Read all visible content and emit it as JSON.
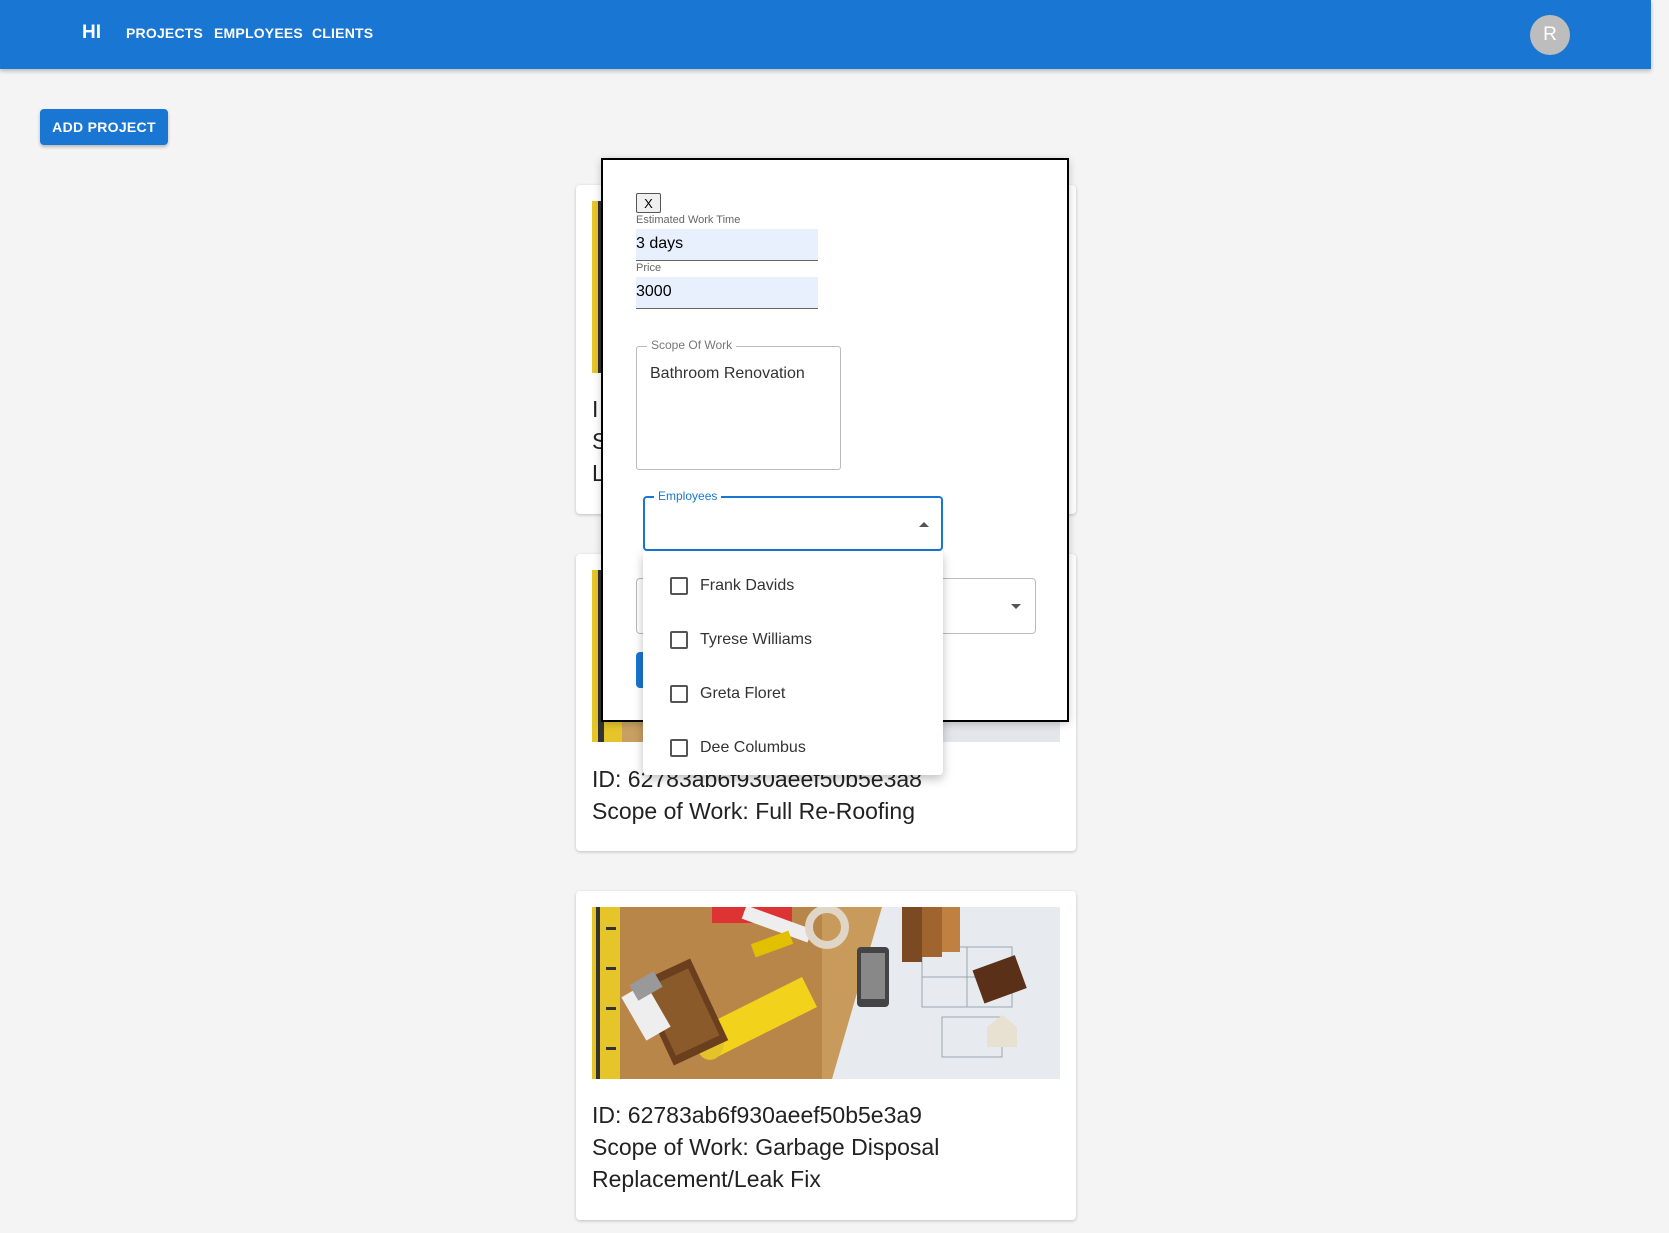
{
  "header": {
    "brand": "HI",
    "nav": [
      "PROJECTS",
      "EMPLOYEES",
      "CLIENTS"
    ],
    "avatar_initial": "R"
  },
  "toolbar": {
    "add_project_label": "ADD PROJECT"
  },
  "cards": [
    {
      "id_line": "ID: 62783ab6f930aeef50b5e3a8",
      "scope_line": "Scope of Work: Full Re-Roofing"
    },
    {
      "id_line": "ID: 62783ab6f930aeef50b5e3a9",
      "scope_line": "Scope of Work: Garbage Disposal Replacement/Leak Fix"
    }
  ],
  "card1_partial_letters": [
    "I",
    "S",
    "L"
  ],
  "modal": {
    "close_label": "X",
    "work_time_label": "Estimated Work Time",
    "work_time_value": "3 days",
    "price_label": "Price",
    "price_value": "3000",
    "scope_label": "Scope Of Work",
    "scope_value": "Bathroom Renovation",
    "employees_label": "Employees",
    "employees_options": [
      "Frank Davids",
      "Tyrese Williams",
      "Greta Floret",
      "Dee Columbus"
    ]
  },
  "colors": {
    "primary": "#1976d2",
    "background": "#f4f4f4",
    "input_fill": "#e8f0fe"
  }
}
